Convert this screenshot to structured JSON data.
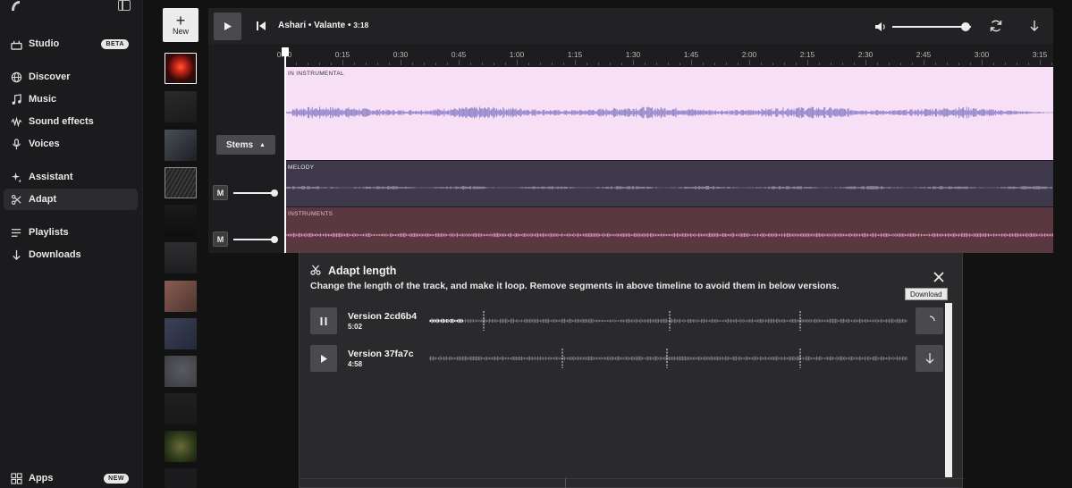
{
  "sidebar": {
    "items": [
      {
        "label": "Studio",
        "badge": "BETA",
        "icon": "studio-icon"
      },
      {
        "label": "Discover",
        "icon": "globe-icon"
      },
      {
        "label": "Music",
        "icon": "music-note-icon"
      },
      {
        "label": "Sound effects",
        "icon": "waveform-icon"
      },
      {
        "label": "Voices",
        "icon": "voice-icon"
      },
      {
        "label": "Assistant",
        "icon": "sparkle-icon"
      },
      {
        "label": "Adapt",
        "icon": "adapt-icon",
        "active": true
      },
      {
        "label": "Playlists",
        "icon": "playlist-icon"
      },
      {
        "label": "Downloads",
        "icon": "download-icon"
      }
    ],
    "apps": {
      "label": "Apps",
      "badge": "NEW"
    }
  },
  "new_button": {
    "label": "New"
  },
  "player": {
    "title": "Ashari • Valante •",
    "duration": "3:18",
    "volume_level": 0.9
  },
  "timeline": {
    "ticks": [
      "0:00",
      "0:15",
      "0:30",
      "0:45",
      "1:00",
      "1:15",
      "1:30",
      "1:45",
      "2:00",
      "2:15",
      "2:30",
      "2:45",
      "3:00",
      "3:15"
    ],
    "tracks": [
      {
        "label": "INSTRUMENTAL",
        "prefix": "IN"
      },
      {
        "label": "MELODY"
      },
      {
        "label": "INSTRUMENTS"
      }
    ],
    "stems_label": "Stems",
    "mute_label": "M"
  },
  "adapt_panel": {
    "title": "Adapt length",
    "description": "Change the length of the track, and make it loop. Remove segments in above timeline to avoid them in below versions.",
    "versions": [
      {
        "name": "Version 2cd6b4",
        "duration": "5:02",
        "state": "playing",
        "action": "loading"
      },
      {
        "name": "Version 37fa7c",
        "duration": "4:58",
        "state": "paused",
        "action": "download"
      }
    ],
    "tooltip": "Download"
  },
  "colors": {
    "instrumental_bg": "#f7e0f6",
    "instrumental_wave": "#8f82c9",
    "melody_bg": "#3e3a4c",
    "instruments_bg": "#5a3840",
    "instruments_wave": "#d88ab5"
  }
}
